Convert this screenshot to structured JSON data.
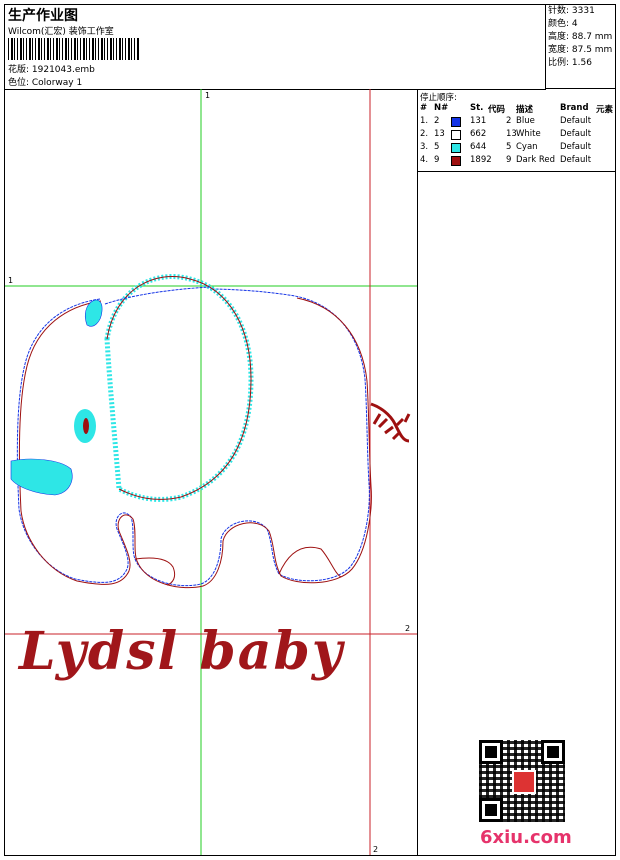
{
  "header": {
    "title": "生产作业图",
    "subtitle": "Wilcom(汇宏) 装饰工作室",
    "file_label": "花版: 1921043.emb",
    "color_label": "色位: Colorway 1"
  },
  "stats": {
    "stitches": "针数: 3331",
    "colors": "颜色: 4",
    "height": "高度: 88.7 mm",
    "width": "宽度: 87.5 mm",
    "scale": "比例: 1.56"
  },
  "stop_sequence": {
    "title": "停止顺序:",
    "columns": [
      "#",
      "N#",
      "St.",
      "代码",
      "描述",
      "Brand",
      "元素"
    ],
    "rows": [
      {
        "idx": "1.",
        "n": "2",
        "color": "#1433e6",
        "st": "131",
        "code": "2",
        "desc": "Blue",
        "brand": "Default"
      },
      {
        "idx": "2.",
        "n": "13",
        "color": "#ffffff",
        "st": "662",
        "code": "13",
        "desc": "White",
        "brand": "Default"
      },
      {
        "idx": "3.",
        "n": "5",
        "color": "#2ee6e6",
        "st": "644",
        "code": "5",
        "desc": "Cyan",
        "brand": "Default"
      },
      {
        "idx": "4.",
        "n": "9",
        "color": "#9e1010",
        "st": "1892",
        "code": "9",
        "desc": "Dark Red",
        "brand": "Default"
      }
    ]
  },
  "axes": {
    "v1": "1",
    "h1": "1",
    "h2": "2",
    "v2": "2"
  },
  "design_text": "Lydsl baby",
  "watermark": "6xiu.com"
}
